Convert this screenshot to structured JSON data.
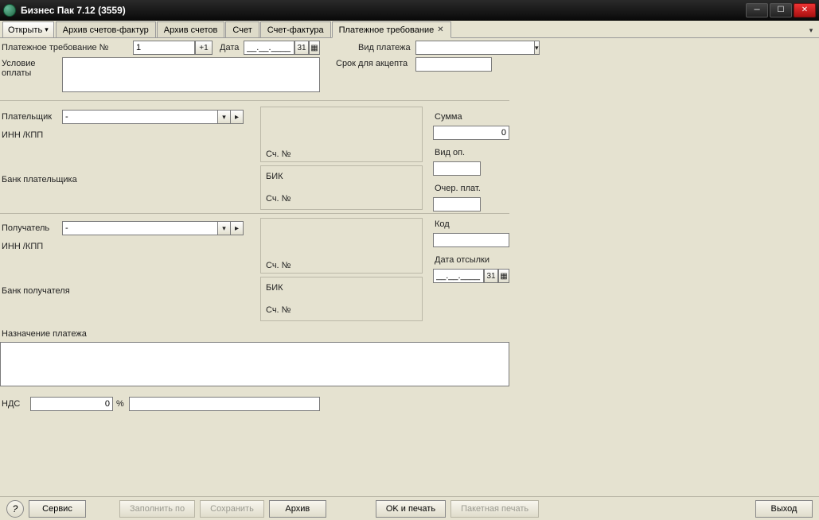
{
  "window": {
    "title": "Бизнес Пак 7.12 (3559)"
  },
  "open_button": "Открыть",
  "tabs": [
    {
      "label": "Архив счетов-фактур"
    },
    {
      "label": "Архив счетов"
    },
    {
      "label": "Счет"
    },
    {
      "label": "Счет-фактура"
    },
    {
      "label": "Платежное требование",
      "active": true,
      "closable": true
    }
  ],
  "row1": {
    "doc_no_label": "Платежное требование №",
    "doc_no_value": "1",
    "inc_label": "+1",
    "date_label": "Дата",
    "date_value": "__.__.____",
    "date_day": "31",
    "payment_kind_label": "Вид платежа",
    "payment_kind_value": ""
  },
  "row2": {
    "terms_label": "Условие оплаты",
    "terms_value": "",
    "accept_label": "Срок для акцепта",
    "accept_value": ""
  },
  "payer": {
    "label": "Плательщик",
    "value": "-",
    "inn_label": "ИНН /КПП",
    "acct_label": "Сч. №"
  },
  "payer_bank": {
    "label": "Банк плательщика",
    "bik_label": "БИК",
    "acct_label": "Сч. №"
  },
  "payee": {
    "label": "Получатель",
    "value": "-",
    "inn_label": "ИНН /КПП",
    "acct_label": "Сч. №"
  },
  "payee_bank": {
    "label": "Банк получателя",
    "bik_label": "БИК",
    "acct_label": "Сч. №"
  },
  "side": {
    "sum_label": "Сумма",
    "sum_value": "0",
    "op_label": "Вид оп.",
    "op_value": "",
    "order_label": "Очер. плат.",
    "order_value": "",
    "code_label": "Код",
    "code_value": "",
    "send_date_label": "Дата отсылки",
    "send_date_value": "__.__.____",
    "send_date_day": "31"
  },
  "purpose": {
    "label": "Назначение платежа",
    "value": ""
  },
  "vat": {
    "label": "НДС",
    "value": "0",
    "pct": "%",
    "amount": ""
  },
  "footer": {
    "help": "?",
    "service": "Сервис",
    "fill_by": "Заполнить по",
    "save": "Сохранить",
    "archive": "Архив",
    "ok_print": "OK и печать",
    "batch_print": "Пакетная печать",
    "exit": "Выход"
  }
}
